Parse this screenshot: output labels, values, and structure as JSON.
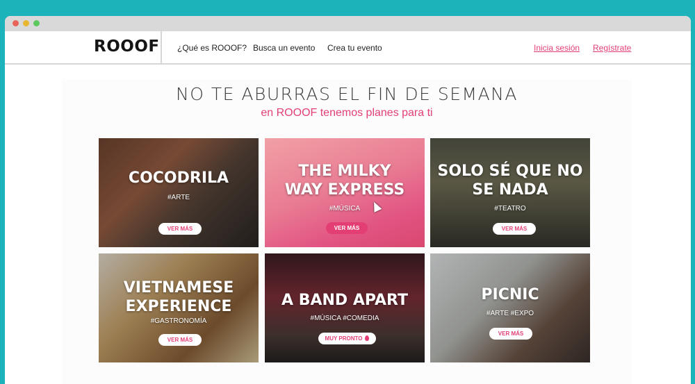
{
  "nav": {
    "logo": "ROOOF",
    "links": [
      "¿Qué es ROOOF?",
      "Busca un evento",
      "Crea tu evento"
    ],
    "login": "Inicia sesión",
    "register": "Regístrate"
  },
  "hero": {
    "title": "NO TE ABURRAS EL FIN DE SEMANA",
    "subtitle": "en ROOOF tenemos planes para ti"
  },
  "cards": [
    {
      "title_lines": [
        "COCODRILA"
      ],
      "tags": "#ARTE",
      "button": "VER MÁS"
    },
    {
      "title_lines": [
        "THE MILKY",
        "WAY EXPRESS"
      ],
      "tags": "#MÚSICA",
      "button": "VER MÁS"
    },
    {
      "title_lines": [
        "SOLO SÉ QUE NO",
        "SE NADA"
      ],
      "tags": "#TEATRO",
      "button": "VER MÁS"
    },
    {
      "title_lines": [
        "VIETNAMESE",
        "EXPERIENCE"
      ],
      "tags": "#GASTRONOMÍA",
      "button": "VER MÁS"
    },
    {
      "title_lines": [
        "A BAND APART"
      ],
      "tags": "#MÚSICA #COMEDIA",
      "button": "MUY PRONTO"
    },
    {
      "title_lines": [
        "PICNIC"
      ],
      "tags": "#ARTE #EXPO",
      "button": "VER MÁS"
    }
  ],
  "colors": {
    "accent": "#e33f75",
    "frame": "#1cb3bb"
  }
}
